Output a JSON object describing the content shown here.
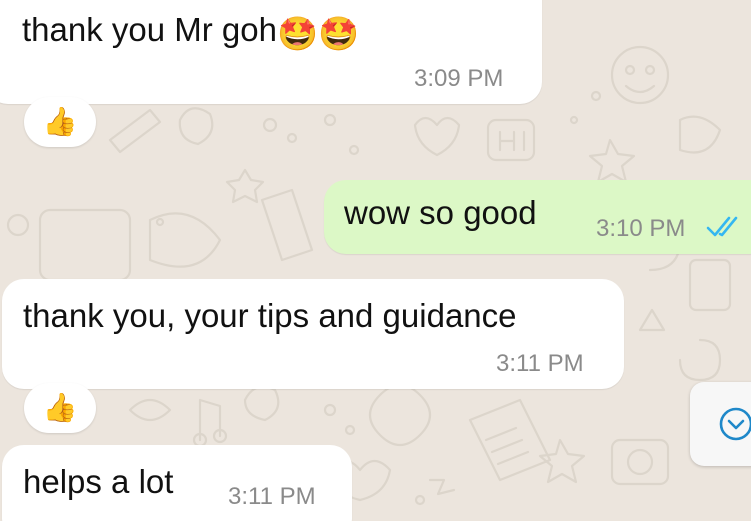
{
  "colors": {
    "wallpaper": "#ece5dd",
    "incoming_bubble": "#ffffff",
    "outgoing_bubble": "#dcf8c6",
    "read_ticks": "#34b7f1",
    "timestamp": "#8a8a8a"
  },
  "messages": [
    {
      "direction": "incoming",
      "text": "thank you Mr goh",
      "emoji_suffix": "🤩🤩",
      "time": "3:09 PM",
      "reaction": "👍"
    },
    {
      "direction": "outgoing",
      "text": "wow so good",
      "time": "3:10 PM",
      "status_icon": "double-check-read-icon"
    },
    {
      "direction": "incoming",
      "text": "thank you, your tips and guidance",
      "time": "3:11 PM",
      "reaction": "👍"
    },
    {
      "direction": "incoming",
      "text": "helps a lot",
      "time": "3:11 PM"
    }
  ],
  "scroll_button_icon": "chevron-down-icon"
}
